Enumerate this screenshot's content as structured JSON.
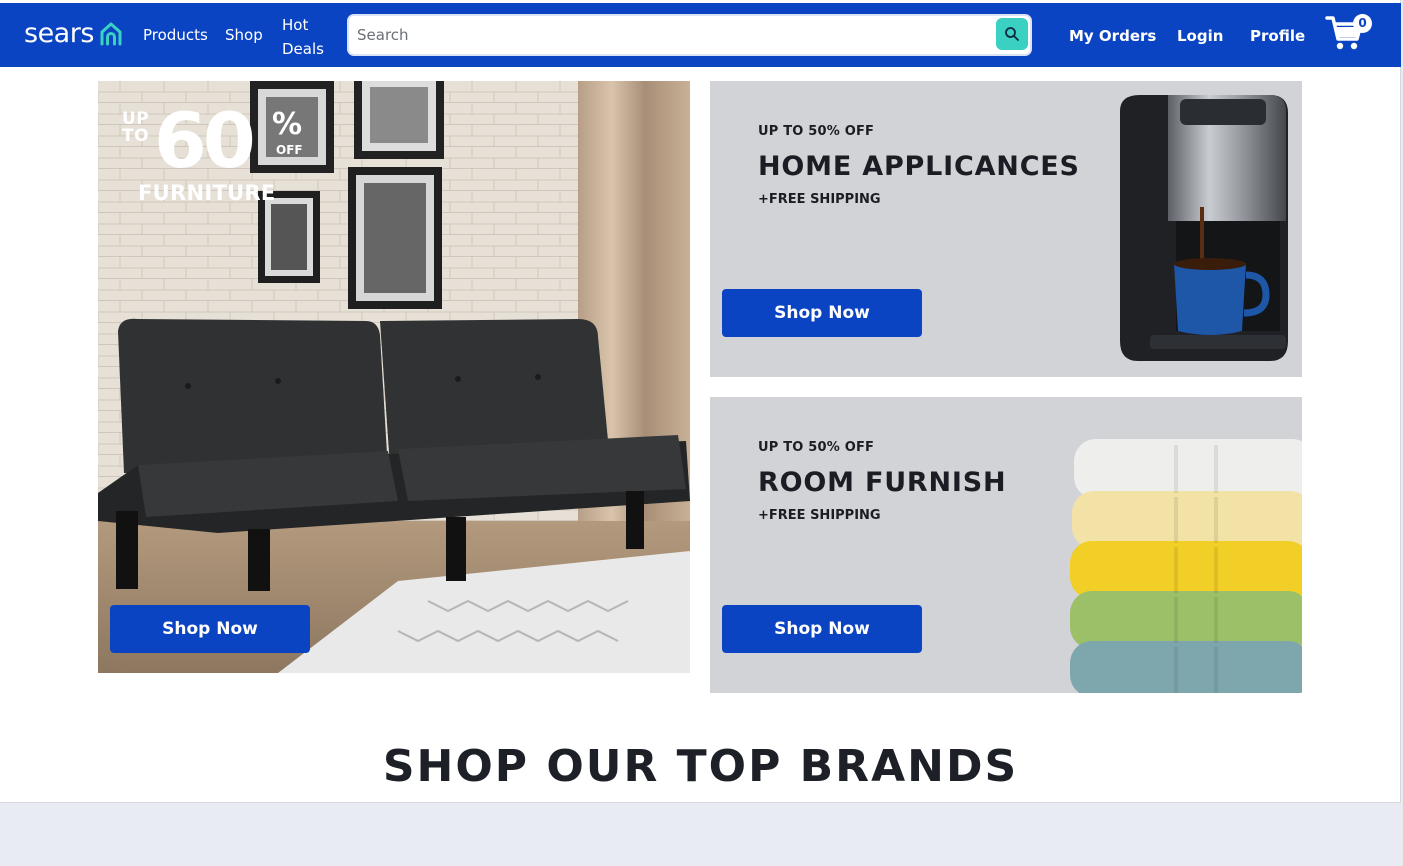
{
  "navbar": {
    "logo_text": "sears",
    "links": {
      "products": "Products",
      "shop": "Shop",
      "hot_deals": "Hot Deals"
    },
    "search": {
      "placeholder": "Search",
      "value": ""
    },
    "right": {
      "orders": "My Orders",
      "login": "Login",
      "profile": "Profile"
    },
    "cart_count": "0"
  },
  "hero": {
    "promo_up_to": "UP TO",
    "promo_amount": "60",
    "promo_percent": "%",
    "promo_off": "OFF",
    "promo_category": "FURNITURE",
    "button": "Shop Now"
  },
  "cards": [
    {
      "deal": "UP TO 50% OFF",
      "title": "HOME APPLICANCES",
      "shipping": "+FREE SHIPPING",
      "button": "Shop Now"
    },
    {
      "deal": "UP TO 50% OFF",
      "title": "ROOM FURNISH",
      "shipping": "+FREE SHIPPING",
      "button": "Shop Now"
    }
  ],
  "brands_heading": "SHOP OUR TOP BRANDS",
  "colors": {
    "brand_blue": "#0b44c2",
    "search_button": "#3ad1c2",
    "card_bg": "#d2d3d6"
  },
  "icons": {
    "search": "search-icon",
    "cart": "cart-icon",
    "logo": "house-icon"
  }
}
